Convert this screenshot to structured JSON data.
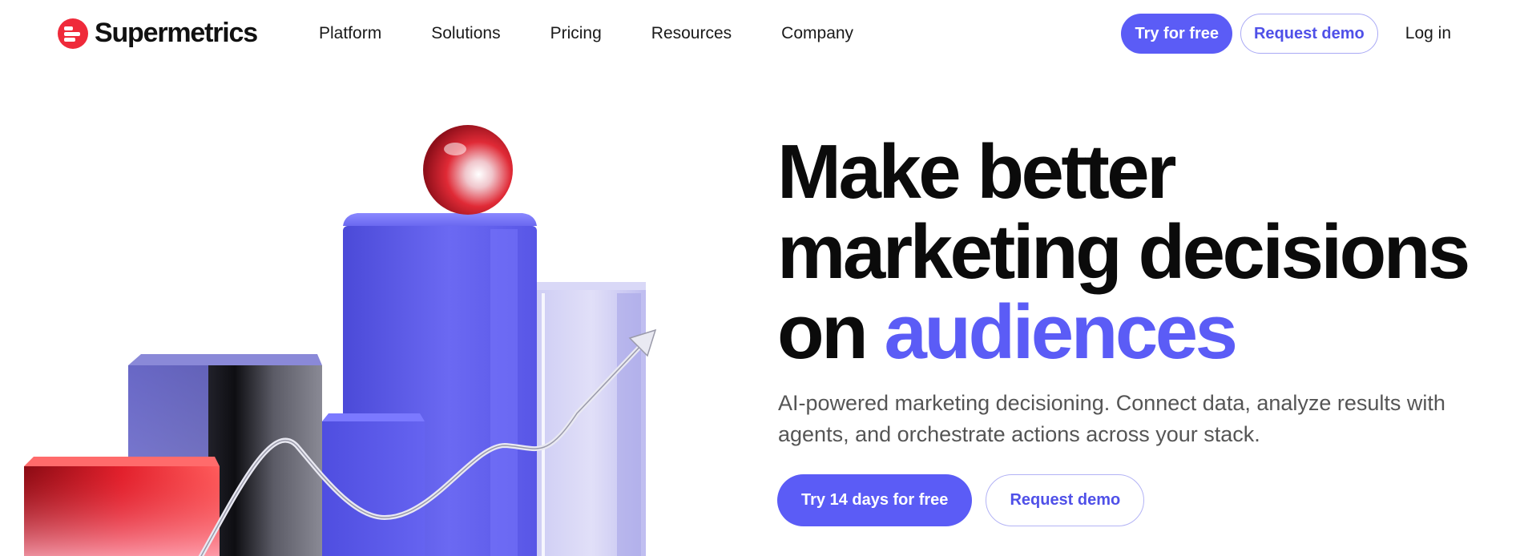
{
  "brand": {
    "name": "Supermetrics",
    "logo_icon": "supermetrics-logo-icon",
    "accent": "#5b5cf6",
    "logo_color": "#ef2a3a"
  },
  "nav": {
    "items": [
      {
        "label": "Platform"
      },
      {
        "label": "Solutions"
      },
      {
        "label": "Pricing"
      },
      {
        "label": "Resources"
      },
      {
        "label": "Company"
      }
    ]
  },
  "header_actions": {
    "try_label": "Try for free",
    "demo_label": "Request demo",
    "login_label": "Log in"
  },
  "hero": {
    "title_line1": "Make better",
    "title_line2": "marketing decisions",
    "title_prefix": "on",
    "title_accent": "audiences",
    "subtitle": "AI-powered marketing decisioning. Connect data, analyze results with agents, and orchestrate actions across your stack.",
    "primary_cta": "Try 14 days for free",
    "secondary_cta": "Request demo"
  }
}
